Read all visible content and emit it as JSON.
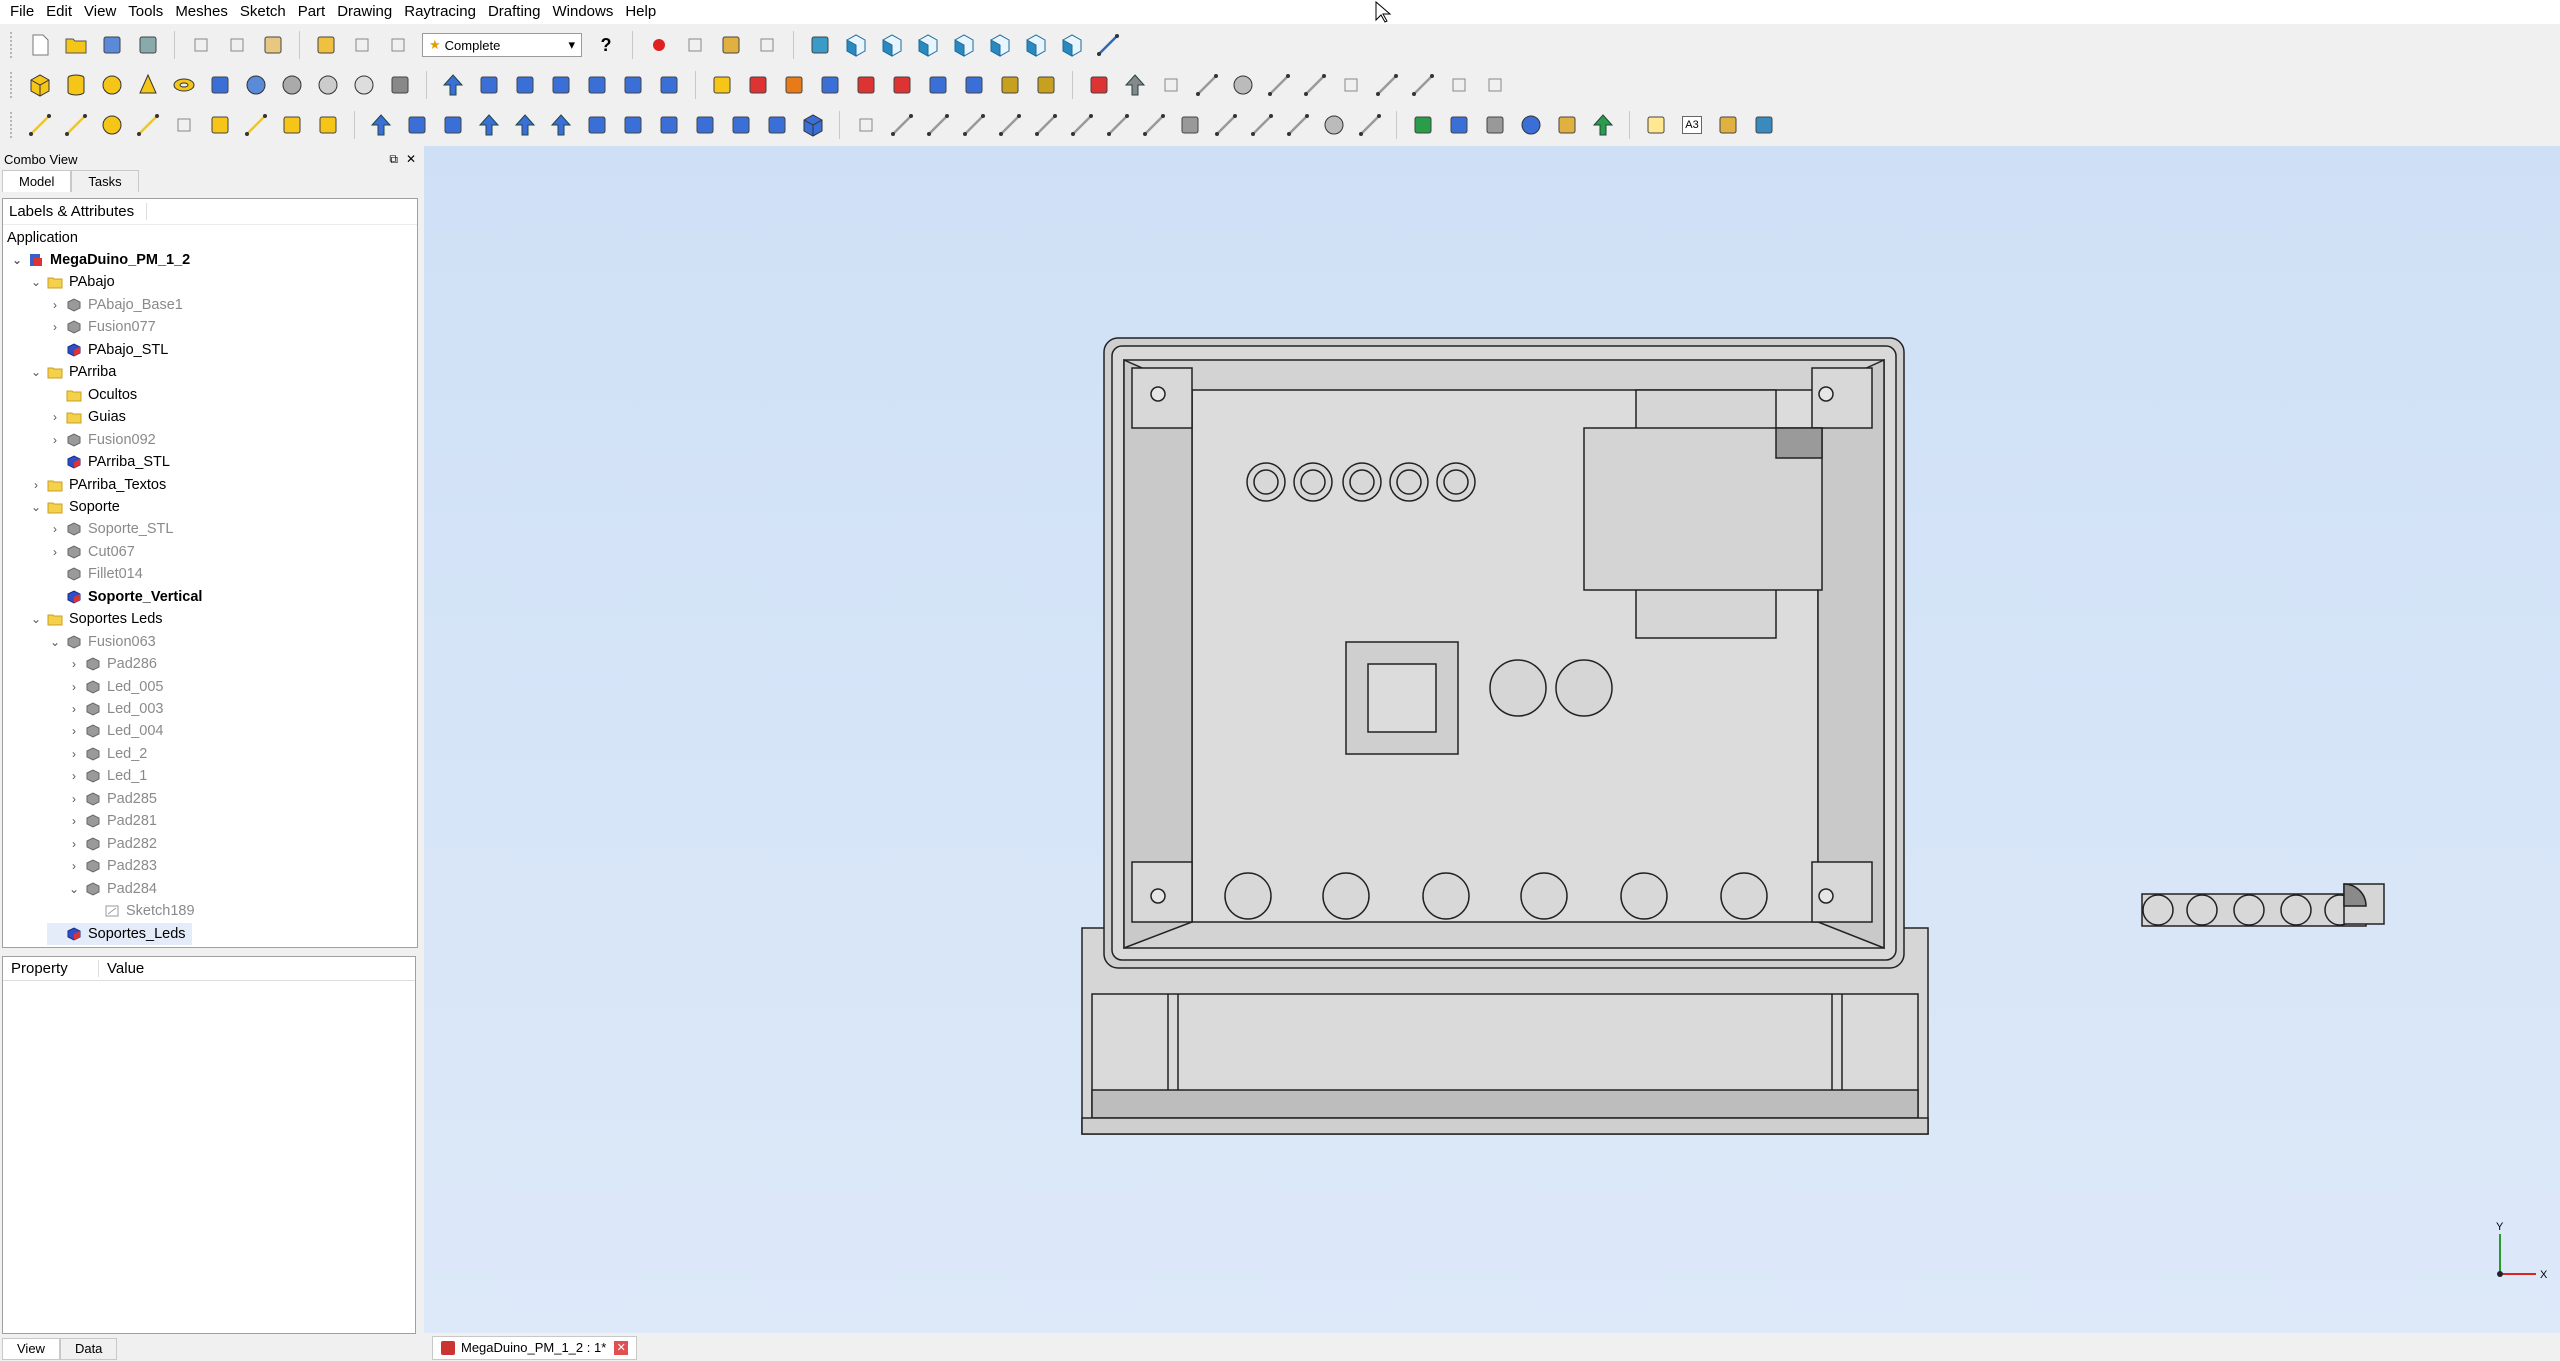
{
  "menu": [
    "File",
    "Edit",
    "View",
    "Tools",
    "Meshes",
    "Sketch",
    "Part",
    "Drawing",
    "Raytracing",
    "Drafting",
    "Windows",
    "Help"
  ],
  "toolbar": {
    "workbench": "Complete",
    "whats_this": "?",
    "a3_label": "A3"
  },
  "combo": {
    "title": "Combo View",
    "tabs": [
      "Model",
      "Tasks"
    ],
    "tree_header": "Labels & Attributes",
    "application": "Application",
    "nodes": [
      {
        "label": "MegaDuino_PM_1_2",
        "depth": 0,
        "arrow": "v",
        "icon": "doc",
        "style": "bold"
      },
      {
        "label": "PAbajo",
        "depth": 1,
        "arrow": "v",
        "icon": "folder",
        "style": ""
      },
      {
        "label": "PAbajo_Base1",
        "depth": 2,
        "arrow": ">",
        "icon": "grey",
        "style": "dim"
      },
      {
        "label": "Fusion077",
        "depth": 2,
        "arrow": ">",
        "icon": "grey",
        "style": "dim"
      },
      {
        "label": "PAbajo_STL",
        "depth": 2,
        "arrow": "",
        "icon": "mesh",
        "style": ""
      },
      {
        "label": "PArriba",
        "depth": 1,
        "arrow": "v",
        "icon": "folder",
        "style": ""
      },
      {
        "label": "Ocultos",
        "depth": 2,
        "arrow": "",
        "icon": "folder",
        "style": ""
      },
      {
        "label": "Guias",
        "depth": 2,
        "arrow": ">",
        "icon": "folder",
        "style": ""
      },
      {
        "label": "Fusion092",
        "depth": 2,
        "arrow": ">",
        "icon": "grey",
        "style": "dim"
      },
      {
        "label": "PArriba_STL",
        "depth": 2,
        "arrow": "",
        "icon": "mesh",
        "style": ""
      },
      {
        "label": "PArriba_Textos",
        "depth": 1,
        "arrow": ">",
        "icon": "folder",
        "style": ""
      },
      {
        "label": "Soporte",
        "depth": 1,
        "arrow": "v",
        "icon": "folder",
        "style": ""
      },
      {
        "label": "Soporte_STL",
        "depth": 2,
        "arrow": ">",
        "icon": "grey",
        "style": "dim"
      },
      {
        "label": "Cut067",
        "depth": 2,
        "arrow": ">",
        "icon": "grey",
        "style": "dim"
      },
      {
        "label": "Fillet014",
        "depth": 2,
        "arrow": "",
        "icon": "grey",
        "style": "dim"
      },
      {
        "label": "Soporte_Vertical",
        "depth": 2,
        "arrow": "",
        "icon": "mesh",
        "style": "bold"
      },
      {
        "label": "Soportes Leds",
        "depth": 1,
        "arrow": "v",
        "icon": "folder",
        "style": ""
      },
      {
        "label": "Fusion063",
        "depth": 2,
        "arrow": "v",
        "icon": "grey",
        "style": "dim"
      },
      {
        "label": "Pad286",
        "depth": 3,
        "arrow": ">",
        "icon": "grey",
        "style": "dim"
      },
      {
        "label": "Led_005",
        "depth": 3,
        "arrow": ">",
        "icon": "grey",
        "style": "dim"
      },
      {
        "label": "Led_003",
        "depth": 3,
        "arrow": ">",
        "icon": "grey",
        "style": "dim"
      },
      {
        "label": "Led_004",
        "depth": 3,
        "arrow": ">",
        "icon": "grey",
        "style": "dim"
      },
      {
        "label": "Led_2",
        "depth": 3,
        "arrow": ">",
        "icon": "grey",
        "style": "dim"
      },
      {
        "label": "Led_1",
        "depth": 3,
        "arrow": ">",
        "icon": "grey",
        "style": "dim"
      },
      {
        "label": "Pad285",
        "depth": 3,
        "arrow": ">",
        "icon": "grey",
        "style": "dim"
      },
      {
        "label": "Pad281",
        "depth": 3,
        "arrow": ">",
        "icon": "grey",
        "style": "dim"
      },
      {
        "label": "Pad282",
        "depth": 3,
        "arrow": ">",
        "icon": "grey",
        "style": "dim"
      },
      {
        "label": "Pad283",
        "depth": 3,
        "arrow": ">",
        "icon": "grey",
        "style": "dim"
      },
      {
        "label": "Pad284",
        "depth": 3,
        "arrow": "v",
        "icon": "grey",
        "style": "dim"
      },
      {
        "label": "Sketch189",
        "depth": 4,
        "arrow": "",
        "icon": "sketch",
        "style": "dim"
      },
      {
        "label": "Soportes_Leds",
        "depth": 2,
        "arrow": "",
        "icon": "mesh",
        "style": "sel"
      }
    ]
  },
  "property": {
    "col1": "Property",
    "col2": "Value",
    "tabs": [
      "View",
      "Data"
    ]
  },
  "axis": {
    "y": "Y",
    "x": "X"
  },
  "document_tab": {
    "label": "MegaDuino_PM_1_2 : 1*"
  },
  "colors": {
    "view_bg_top": "#cfe0f6",
    "view_bg_bottom": "#dde9f9",
    "model_face": "#d6d6d6",
    "model_edge": "#222222"
  }
}
